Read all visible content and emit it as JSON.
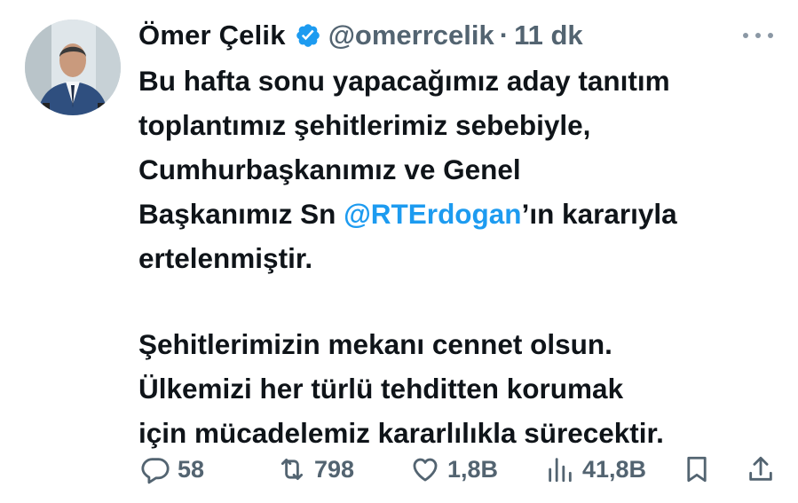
{
  "author": {
    "name": "Ömer Çelik",
    "handle": "@omerrcelik",
    "separator": "·",
    "time": "11 dk",
    "verified": true
  },
  "tweet": {
    "line1": "Bu hafta sonu yapacağımız aday tanıtım",
    "line2": "toplantımız şehitlerimiz sebebiyle,",
    "line3": "Cumhurbaşkanımız ve Genel",
    "line4_before": "Başkanımız Sn ",
    "mention": "@RTErdogan",
    "line4_after": "’ın kararıyla",
    "line5": "ertelenmiştir.",
    "line6": "Şehitlerimizin mekanı cennet olsun.",
    "line7": "Ülkemizi her türlü tehditten korumak",
    "line8": "için mücadelemiz kararlılıkla sürecektir."
  },
  "actions": {
    "replies": "58",
    "retweets": "798",
    "likes": "1,8B",
    "views": "41,8B"
  },
  "icons": {
    "verified": "verified-badge-icon",
    "more": "more-dots-icon",
    "reply": "reply-icon",
    "retweet": "retweet-icon",
    "like": "heart-icon",
    "views": "views-chart-icon",
    "bookmark": "bookmark-icon",
    "share": "share-icon"
  },
  "colors": {
    "text": "#0f1419",
    "secondary": "#536471",
    "mention": "#1d9bf0",
    "verified": "#1d9bf0"
  }
}
